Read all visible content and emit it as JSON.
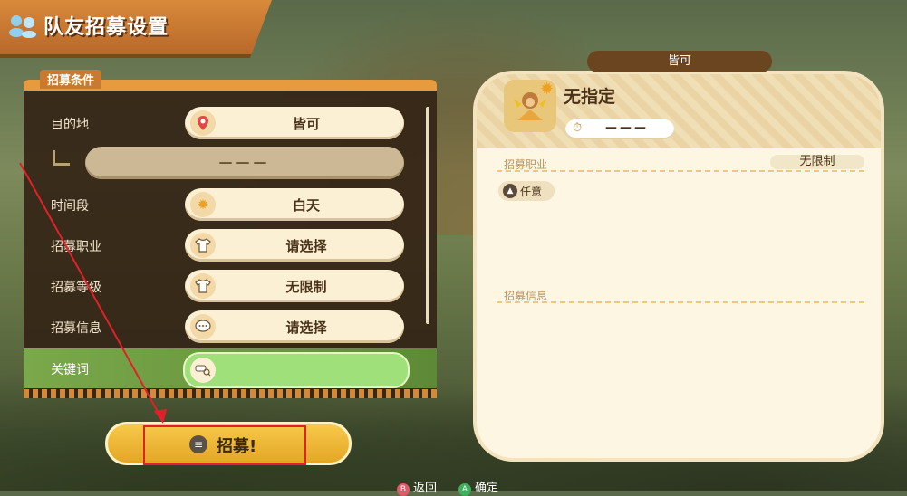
{
  "title": "队友招募设置",
  "conditions": {
    "section_label": "招募条件",
    "rows": [
      {
        "label": "目的地",
        "value": "皆可",
        "icon": "location-pin-icon"
      },
      {
        "label": "",
        "value": "———",
        "icon": ""
      },
      {
        "label": "时间段",
        "value": "白天",
        "icon": "sun-icon"
      },
      {
        "label": "招募职业",
        "value": "请选择",
        "icon": "shirt-icon"
      },
      {
        "label": "招募等级",
        "value": "无限制",
        "icon": "shirt-icon"
      },
      {
        "label": "招募信息",
        "value": "请选择",
        "icon": "speech-bubble-icon"
      },
      {
        "label": "关键词",
        "value": "",
        "icon": "key-icon"
      }
    ]
  },
  "recruit_button": {
    "label": "招募!"
  },
  "preview": {
    "tab_label": "皆可",
    "destination": "无指定",
    "time_value": "———",
    "job_section": "招募职业",
    "level_value": "无限制",
    "job_tag": "任意",
    "info_section": "招募信息"
  },
  "hints": {
    "back": "返回",
    "confirm": "确定",
    "back_key": "B",
    "confirm_key": "A"
  },
  "colors": {
    "accent_orange": "#e89a3e",
    "panel_dark": "#34241680",
    "highlight_green": "#9fe07a",
    "red_annotation": "#e3202a"
  }
}
